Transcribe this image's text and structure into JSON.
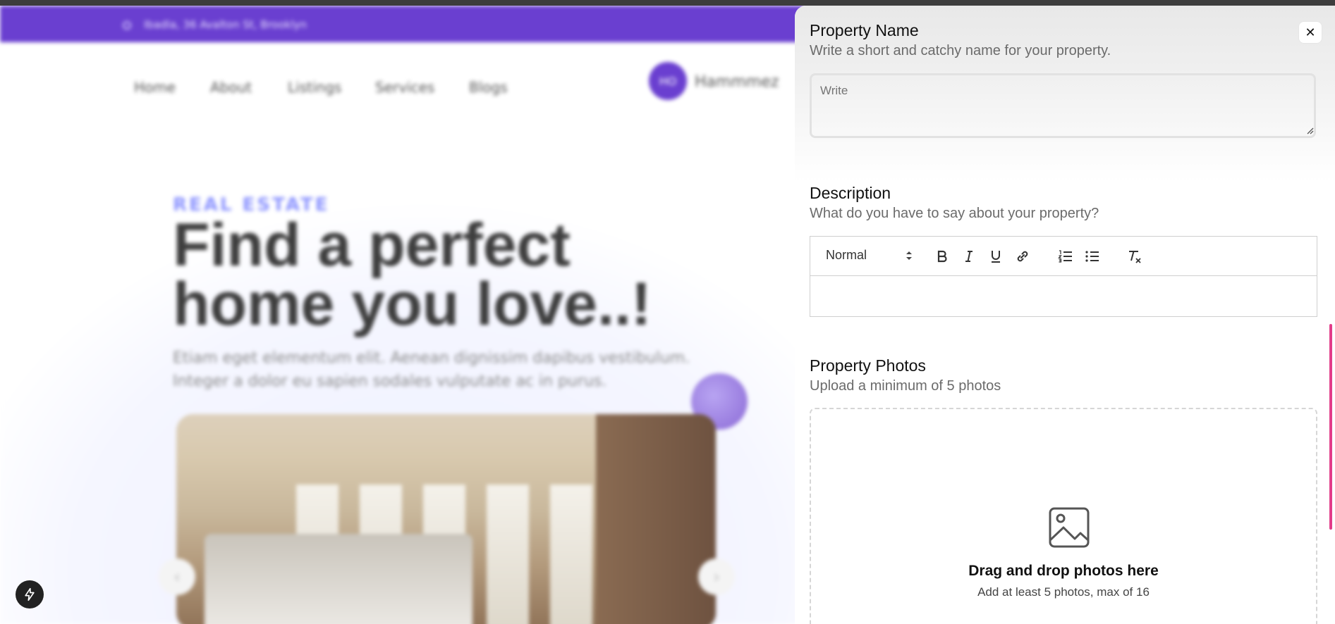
{
  "background_page": {
    "promo_text": "Ibadla, 36 Avalton St, Brooklyn",
    "nav_items": [
      "Home",
      "About",
      "Listings",
      "Services",
      "Blogs"
    ],
    "user": {
      "avatar_initials": "HO",
      "name": "Hammmez"
    },
    "hero": {
      "kicker": "REAL ESTATE",
      "title": "Find a perfect home you love..!",
      "subtitle": "Etiam eget elementum elit. Aenean dignissim dapibus vestibulum. Integer a dolor eu sapien sodales vulputate ac in purus."
    }
  },
  "panel": {
    "close_label": "✕",
    "property_name": {
      "title": "Property Name",
      "subtitle": "Write a short and catchy name for your property.",
      "placeholder": "Write"
    },
    "description": {
      "title": "Description",
      "subtitle": "What do you have to say about your property?",
      "format_select": "Normal"
    },
    "photos": {
      "title": "Property Photos",
      "subtitle": "Upload a minimum of 5 photos",
      "dropzone_title": "Drag and drop photos here",
      "dropzone_sub": "Add at least 5 photos, max of 16"
    }
  },
  "colors": {
    "promo_bg": "#6a3fd0",
    "scroll_thumb": "#e23d8a",
    "text_primary": "#111111",
    "text_secondary": "#6b6b6b"
  },
  "icons": {
    "fab": "lightning-icon",
    "dropzone": "image-icon",
    "toolbar": [
      "bold-icon",
      "italic-icon",
      "underline-icon",
      "link-icon",
      "ordered-list-icon",
      "bullet-list-icon",
      "clear-format-icon"
    ]
  }
}
